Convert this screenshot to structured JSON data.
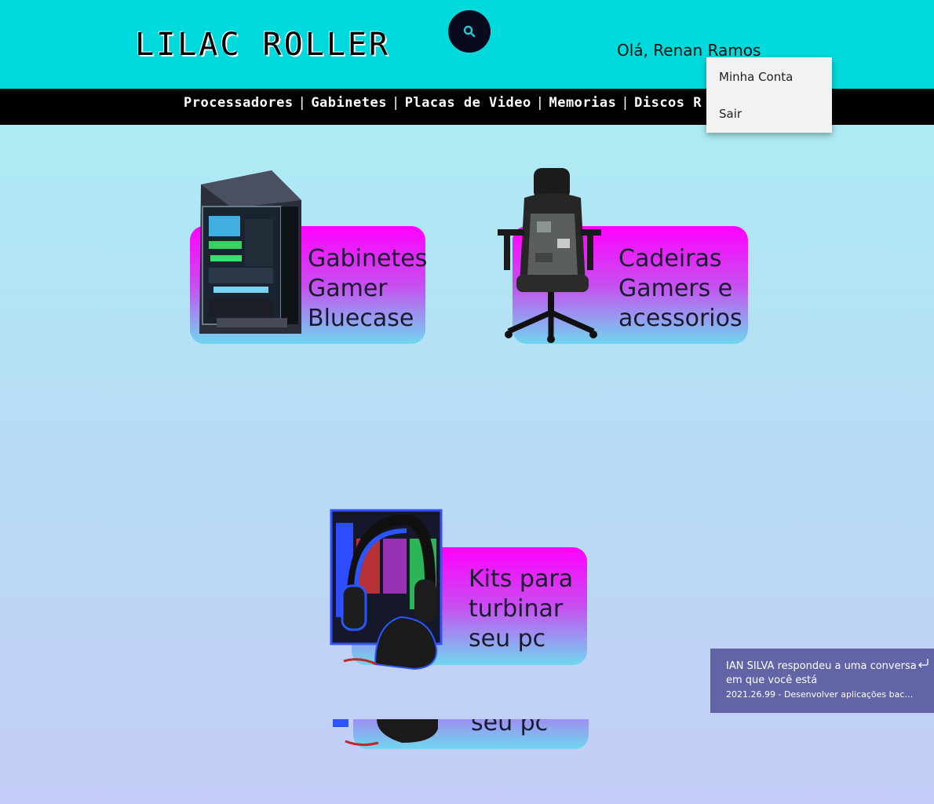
{
  "header": {
    "logo": "LILAC ROLLER",
    "search_icon": "search-icon",
    "greeting": "Olá, Renan Ramos",
    "bg_color": "#00dadd"
  },
  "nav": {
    "items": [
      "Processadores",
      "Gabinetes",
      "Placas de Video",
      "Memorias",
      "Discos R"
    ],
    "separator": "|"
  },
  "user_menu": {
    "items": [
      "Minha Conta",
      "Sair"
    ]
  },
  "categories": [
    {
      "lines": [
        "Gabinetes",
        "Gamer",
        "Bluecase"
      ],
      "image": "pc-case-image"
    },
    {
      "lines": [
        "Cadeiras",
        "Gamers e",
        "acessorios"
      ],
      "image": "gaming-chair-image"
    },
    {
      "lines": [
        "Kits para",
        "turbinar",
        "seu pc"
      ],
      "image": "headset-kit-image"
    }
  ],
  "reflection_text": "seu pc",
  "notification": {
    "title": "IAN SILVA respondeu a uma conversa em que você está",
    "subtitle": "2021.26.99 - Desenvolver aplicações back-...",
    "icon": "reply-icon",
    "bg_color": "#6264a7"
  }
}
